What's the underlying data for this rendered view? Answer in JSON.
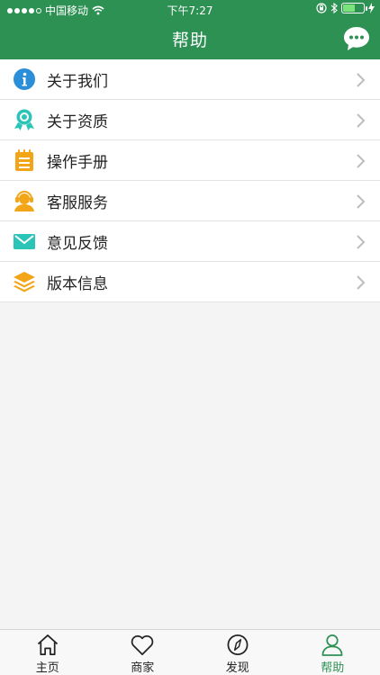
{
  "status_bar": {
    "carrier": "中国移动",
    "time": "下午7:27",
    "battery_level": 0.6
  },
  "header": {
    "title": "帮助",
    "chat_icon": "chat-bubble-icon"
  },
  "menu": [
    {
      "label": "关于我们",
      "icon": "info-icon",
      "color": "#2a8fd8"
    },
    {
      "label": "关于资质",
      "icon": "award-icon",
      "color": "#2dc4b8"
    },
    {
      "label": "操作手册",
      "icon": "notepad-icon",
      "color": "#f2a516"
    },
    {
      "label": "客服服务",
      "icon": "customer-service-icon",
      "color": "#f2a516"
    },
    {
      "label": "意见反馈",
      "icon": "mail-icon",
      "color": "#2dc4b8"
    },
    {
      "label": "版本信息",
      "icon": "layers-icon",
      "color": "#f2a516"
    }
  ],
  "tabs": [
    {
      "label": "主页",
      "icon": "home-icon",
      "active": false
    },
    {
      "label": "商家",
      "icon": "heart-icon",
      "active": false
    },
    {
      "label": "发现",
      "icon": "compass-icon",
      "active": false
    },
    {
      "label": "帮助",
      "icon": "user-icon",
      "active": true
    }
  ],
  "colors": {
    "brand_green": "#2e9154",
    "background": "#f4f4f4"
  }
}
